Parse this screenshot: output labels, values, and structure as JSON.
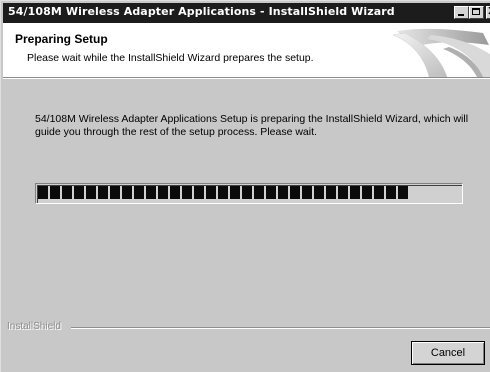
{
  "window": {
    "title": "54/108M Wireless Adapter Applications - InstallShield Wizard",
    "controls": {
      "minimize": "minimize",
      "maximize": "maximize",
      "close": "X"
    }
  },
  "header": {
    "title": "Preparing Setup",
    "subtitle": "Please wait while the InstallShield Wizard prepares the setup."
  },
  "body": {
    "message": "54/108M Wireless Adapter Applications Setup is preparing the InstallShield Wizard, which will guide you through the rest of the setup process. Please wait."
  },
  "progress": {
    "fraction": 0.88
  },
  "footer": {
    "brand": "InstallShield",
    "cancel_label": "Cancel"
  },
  "icons": {
    "header_graphic": "swoosh-graphic-icon",
    "minimize": "minimize-icon",
    "maximize": "maximize-icon",
    "close": "close-icon"
  },
  "colors": {
    "titlebar": "#1c1c1c",
    "window_bg": "#c8c8c8",
    "header_bg": "#ffffff",
    "progress_block": "#0a0a0a",
    "brand_text": "#8e8e8e"
  }
}
